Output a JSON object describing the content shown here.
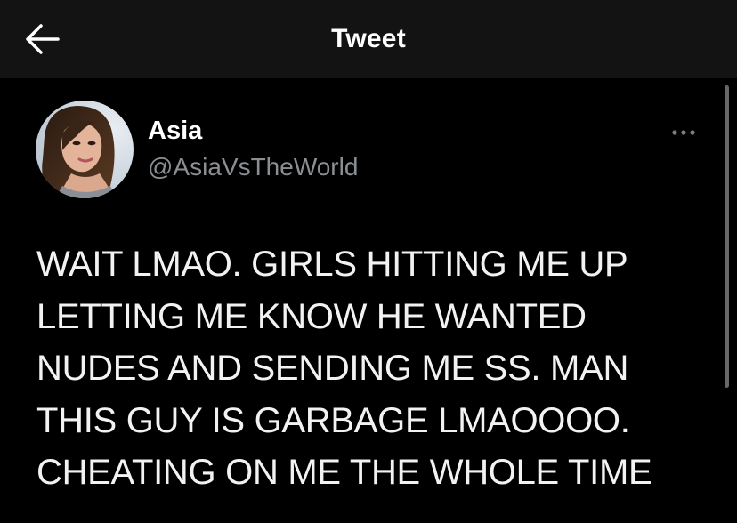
{
  "header": {
    "title": "Tweet",
    "back_icon": "arrow-left-icon"
  },
  "tweet": {
    "author": {
      "display_name": "Asia",
      "handle": "@AsiaVsTheWorld",
      "avatar_icon": "profile-photo"
    },
    "more_icon": "ellipsis-icon",
    "lines": [
      "WAIT LMAO. GIRLS HITTING ME UP",
      "LETTING ME KNOW HE WANTED",
      "NUDES AND SENDING ME SS. MAN",
      "THIS GUY IS GARBAGE LMAOOOO.",
      "CHEATING ON ME THE WHOLE TIME"
    ]
  },
  "colors": {
    "background": "#000000",
    "header_background": "#131313",
    "text_primary": "#ffffff",
    "text_secondary": "#8b8f94"
  }
}
